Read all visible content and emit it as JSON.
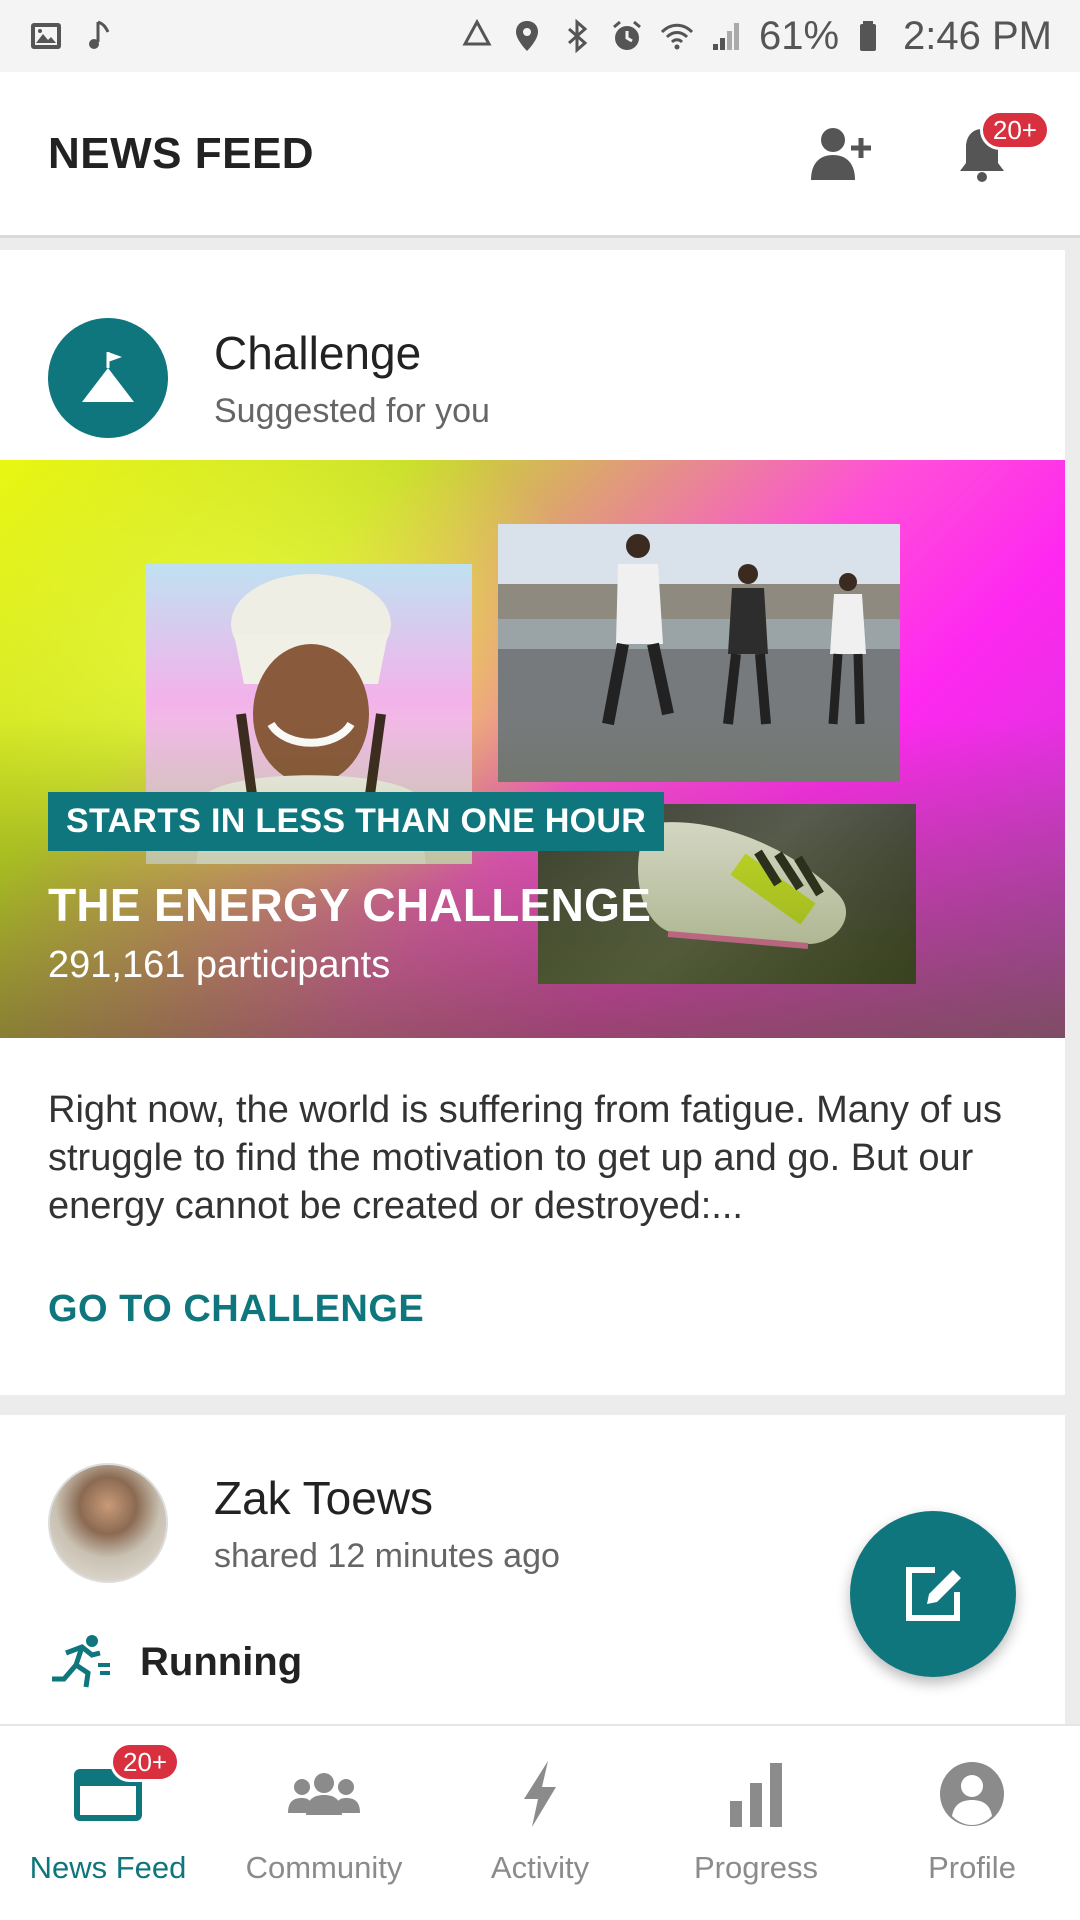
{
  "status_bar": {
    "battery": "61%",
    "time": "2:46 PM"
  },
  "header": {
    "title": "NEWS FEED",
    "notifications_badge": "20+"
  },
  "challenge_card": {
    "title": "Challenge",
    "subtitle": "Suggested for you",
    "tag": "STARTS IN LESS THAN ONE HOUR",
    "challenge_name": "THE ENERGY CHALLENGE",
    "participants": "291,161 participants",
    "description": "Right now, the world is suffering from fatigue. Many of us struggle to find the motivation to get up and go. But our energy cannot be created or destroyed:...",
    "cta_label": "GO TO CHALLENGE"
  },
  "post_card": {
    "user_name": "Zak Toews",
    "meta": "shared 12 minutes ago",
    "sport": "Running"
  },
  "bottom_nav": {
    "items": [
      {
        "label": "News Feed",
        "badge": "20+",
        "icon": "news-feed-icon",
        "active": true
      },
      {
        "label": "Community",
        "icon": "community-icon"
      },
      {
        "label": "Activity",
        "icon": "activity-icon"
      },
      {
        "label": "Progress",
        "icon": "progress-icon"
      },
      {
        "label": "Profile",
        "icon": "profile-icon"
      }
    ]
  },
  "colors": {
    "accent": "#0f767d",
    "badge": "#d8303f",
    "inactive": "#8b8b8b"
  }
}
